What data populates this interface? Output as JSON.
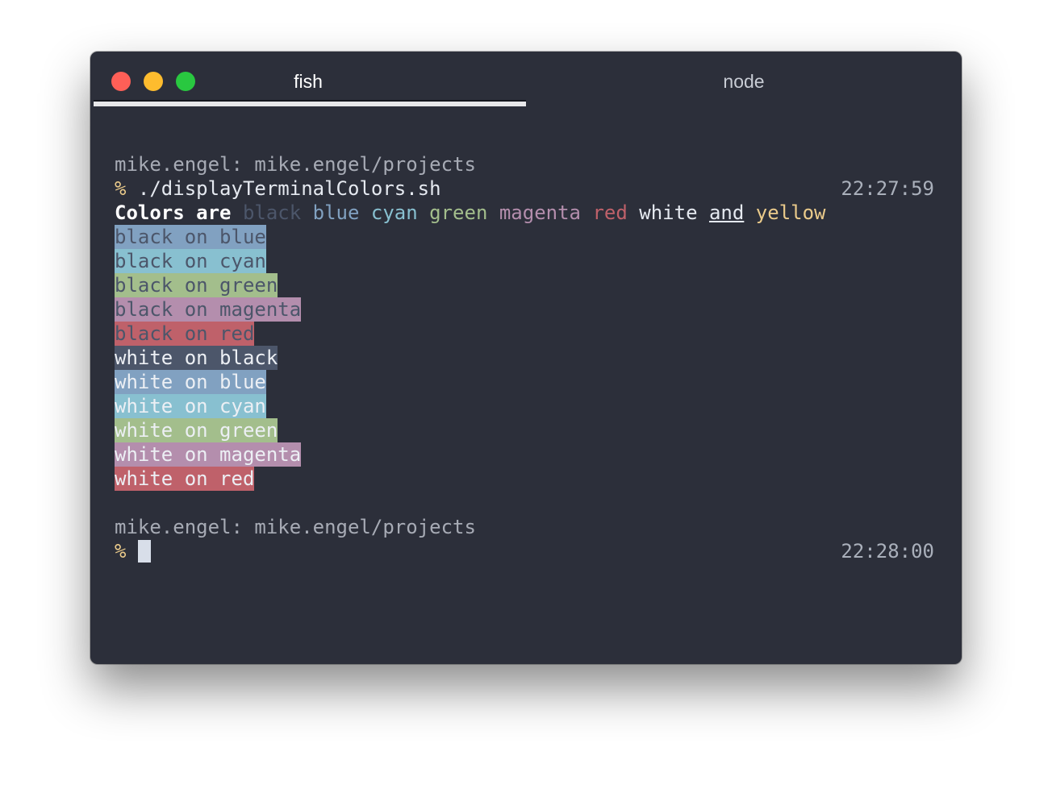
{
  "window": {
    "tabs": [
      {
        "label": "fish",
        "active": true
      },
      {
        "label": "node",
        "active": false
      }
    ]
  },
  "terminal": {
    "prompt1": {
      "path": "mike.engel: mike.engel/projects",
      "symbol": "%",
      "command": " ./displayTerminalColors.sh",
      "time": "22:27:59"
    },
    "colors_line": {
      "lead": "Colors are",
      "words": [
        "black",
        "blue",
        "cyan",
        "green",
        "magenta",
        "red",
        "white",
        "and",
        "yellow"
      ]
    },
    "swatches": [
      {
        "text": "black on blue",
        "fg": "black",
        "bg": "blue"
      },
      {
        "text": "black on cyan",
        "fg": "black",
        "bg": "cyan"
      },
      {
        "text": "black on green",
        "fg": "black",
        "bg": "green"
      },
      {
        "text": "black on magenta",
        "fg": "black",
        "bg": "magenta"
      },
      {
        "text": "black on red",
        "fg": "black",
        "bg": "red"
      },
      {
        "text": "white on black",
        "fg": "white",
        "bg": "black"
      },
      {
        "text": "white on blue",
        "fg": "white",
        "bg": "blue"
      },
      {
        "text": "white on cyan",
        "fg": "white",
        "bg": "cyan"
      },
      {
        "text": "white on green",
        "fg": "white",
        "bg": "green"
      },
      {
        "text": "white on magenta",
        "fg": "white",
        "bg": "magenta"
      },
      {
        "text": "white on red",
        "fg": "white",
        "bg": "red"
      }
    ],
    "prompt2": {
      "path": "mike.engel: mike.engel/projects",
      "symbol": "%",
      "time": "22:28:00"
    }
  },
  "colors": {
    "background": "#2c2f3a",
    "black": "#4c566a",
    "blue": "#81a1c1",
    "cyan": "#88c0d0",
    "green": "#a3be8c",
    "magenta": "#b48ead",
    "red": "#bf616a",
    "white": "#e5e9f0",
    "yellow": "#ebcb8b"
  }
}
